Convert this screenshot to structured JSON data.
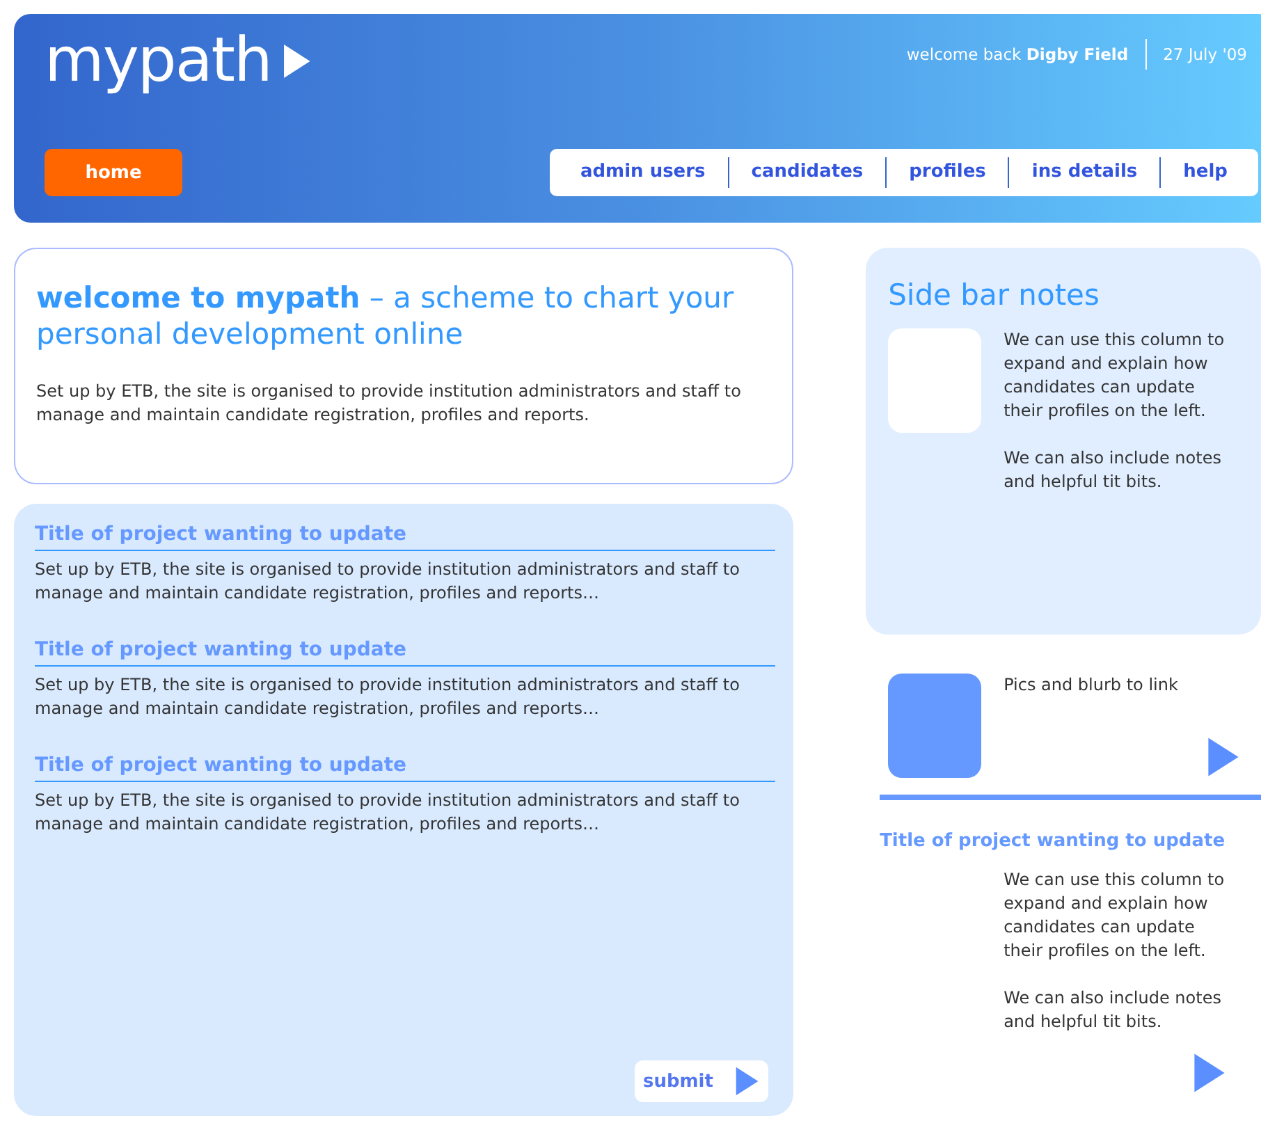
{
  "header": {
    "logo": "mypath",
    "welcome": "welcome back",
    "user": "Digby Field",
    "date": "27 July '09",
    "home": "home",
    "nav": [
      "admin users",
      "candidates",
      "profiles",
      "ins details",
      "help"
    ]
  },
  "intro": {
    "heading": "**welcome to mypath** – a scheme to chart your personal development online",
    "text": "Set up by ETB, the site is organised to provide institution administrators and staff to manage and maintain candidate registration, profiles and reports."
  },
  "projects": [
    {
      "title": "Title of project wanting to update",
      "text": "Set up by ETB, the site is organised to provide institution administrators and staff to manage and maintain candidate registration, profiles and reports…"
    },
    {
      "title": "Title of project wanting to update",
      "text": "Set up by ETB, the site is organised to provide institution administrators and staff to manage and maintain candidate registration, profiles and reports…"
    },
    {
      "title": "Title of project wanting to update",
      "text": "Set up by ETB, the site is organised to provide institution administrators and staff to manage and maintain candidate registration, profiles and reports…"
    }
  ],
  "submit": "submit",
  "sidebar": {
    "title": "Side bar notes",
    "paragraphs": [
      "We can use this column to expand and explain how candidates can update their profiles on the left.",
      "We can also include notes and helpful tit bits."
    ]
  },
  "link_card": {
    "text": "Pics and blurb to link"
  },
  "feature": {
    "title": "Title of project wanting to update",
    "paragraphs": [
      "We can use this column to expand and explain how candidates can update their profiles on the left.",
      "We can also include notes and helpful tit bits."
    ]
  }
}
